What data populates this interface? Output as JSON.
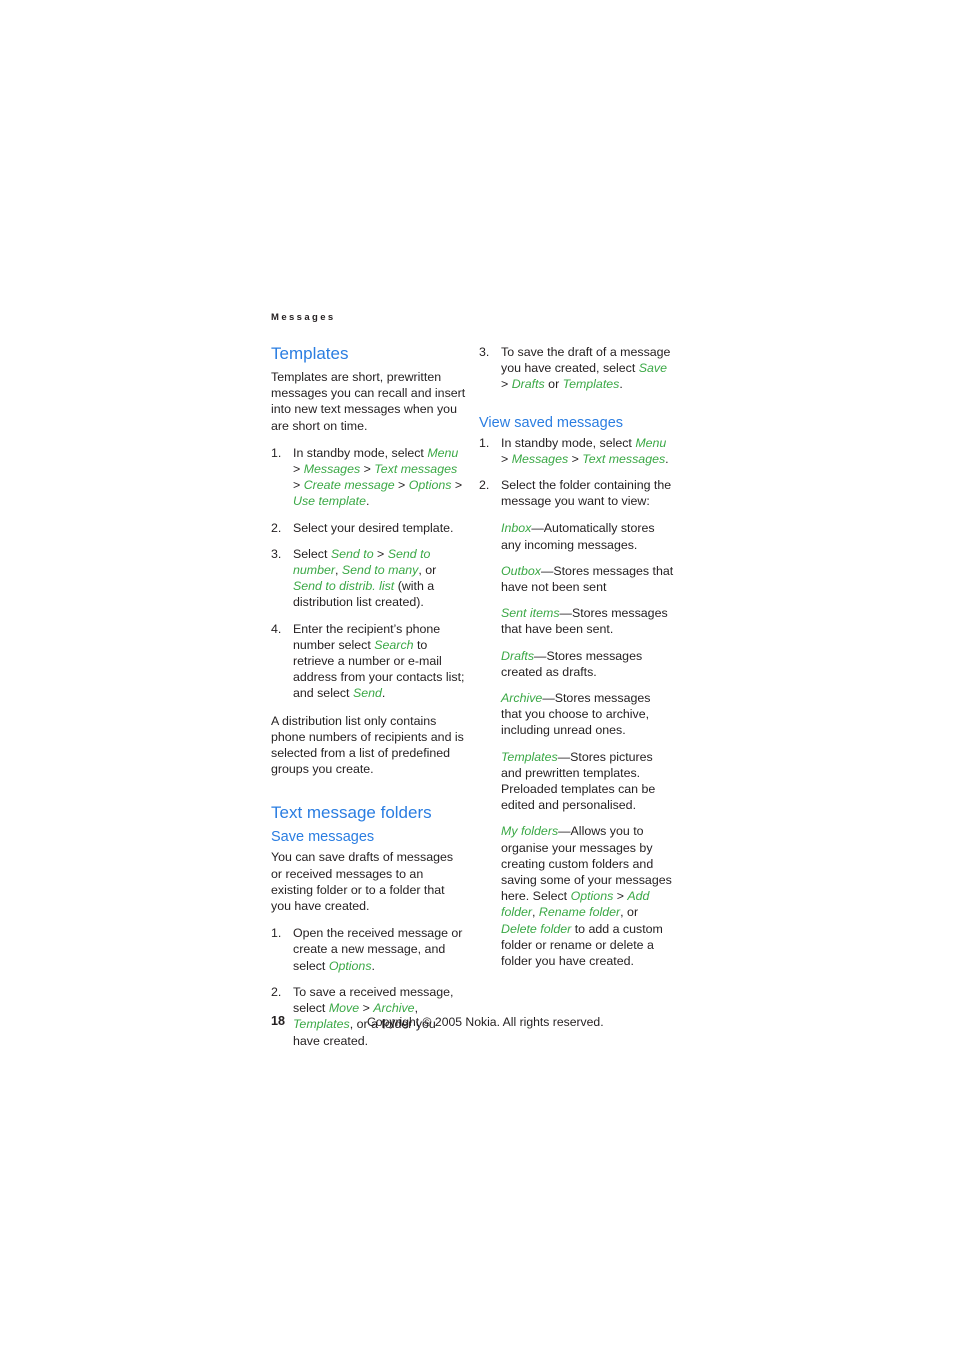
{
  "running_header": "Messages",
  "colors": {
    "heading_blue": "#2a7de1",
    "ui_green": "#3aa845",
    "body_text": "#231f20"
  },
  "left_column": {
    "heading_templates": "Templates",
    "intro": "Templates are short, prewritten messages you can recall and insert into new text messages when you are short on time.",
    "steps": [
      {
        "num": "1.",
        "parts": [
          {
            "t": "In standby mode, select ",
            "k": "plain"
          },
          {
            "t": "Menu",
            "k": "ui"
          },
          {
            "t": " > ",
            "k": "sep"
          },
          {
            "t": "Messages",
            "k": "ui"
          },
          {
            "t": " > ",
            "k": "sep"
          },
          {
            "t": "Text messages",
            "k": "ui"
          },
          {
            "t": " > ",
            "k": "sep"
          },
          {
            "t": "Create message",
            "k": "ui"
          },
          {
            "t": " > ",
            "k": "sep"
          },
          {
            "t": "Options",
            "k": "ui"
          },
          {
            "t": " > ",
            "k": "sep"
          },
          {
            "t": "Use template",
            "k": "ui"
          },
          {
            "t": ".",
            "k": "plain"
          }
        ]
      },
      {
        "num": "2.",
        "parts": [
          {
            "t": "Select your desired template.",
            "k": "plain"
          }
        ]
      },
      {
        "num": "3.",
        "parts": [
          {
            "t": "Select ",
            "k": "plain"
          },
          {
            "t": "Send to",
            "k": "ui"
          },
          {
            "t": " > ",
            "k": "sep"
          },
          {
            "t": "Send to number",
            "k": "ui"
          },
          {
            "t": ", ",
            "k": "plain"
          },
          {
            "t": "Send to many",
            "k": "ui"
          },
          {
            "t": ", or ",
            "k": "plain"
          },
          {
            "t": "Send to distrib. list",
            "k": "ui"
          },
          {
            "t": " (with a distribution list created).",
            "k": "plain"
          }
        ]
      },
      {
        "num": "4.",
        "parts": [
          {
            "t": "Enter the recipient’s phone number select ",
            "k": "plain"
          },
          {
            "t": "Search",
            "k": "ui"
          },
          {
            "t": " to retrieve a number or e-mail address from your contacts list; and select ",
            "k": "plain"
          },
          {
            "t": "Send",
            "k": "ui"
          },
          {
            "t": ".",
            "k": "plain"
          }
        ]
      }
    ],
    "distribution_note": "A distribution list only contains phone numbers of recipients and is selected from a list of predefined groups you create.",
    "heading_folders": "Text message folders",
    "subheading_save": "Save messages",
    "save_intro": "You can save drafts of messages or received messages to an existing folder or to a folder that you have created.",
    "save_steps": [
      {
        "num": "1.",
        "parts": [
          {
            "t": "Open the received message or create a new message, and select ",
            "k": "plain"
          },
          {
            "t": "Options",
            "k": "ui"
          },
          {
            "t": ".",
            "k": "plain"
          }
        ]
      },
      {
        "num": "2.",
        "parts": [
          {
            "t": "To save a received message, select ",
            "k": "plain"
          },
          {
            "t": "Move",
            "k": "ui"
          },
          {
            "t": " > ",
            "k": "sep"
          },
          {
            "t": "Archive",
            "k": "ui"
          },
          {
            "t": ", ",
            "k": "plain"
          },
          {
            "t": "Templates",
            "k": "ui"
          },
          {
            "t": ", or a folder you have created.",
            "k": "plain"
          }
        ]
      }
    ]
  },
  "right_column": {
    "step3": {
      "num": "3.",
      "parts": [
        {
          "t": "To save the draft of a message you have created, select ",
          "k": "plain"
        },
        {
          "t": "Save",
          "k": "ui"
        },
        {
          "t": " > ",
          "k": "sep"
        },
        {
          "t": "Drafts",
          "k": "ui"
        },
        {
          "t": " or ",
          "k": "plain"
        },
        {
          "t": "Templates",
          "k": "ui"
        },
        {
          "t": ".",
          "k": "plain"
        }
      ]
    },
    "subheading_view": "View saved messages",
    "view_steps": [
      {
        "num": "1.",
        "parts": [
          {
            "t": "In standby mode, select ",
            "k": "plain"
          },
          {
            "t": "Menu",
            "k": "ui"
          },
          {
            "t": " > ",
            "k": "sep"
          },
          {
            "t": "Messages",
            "k": "ui"
          },
          {
            "t": " > ",
            "k": "sep"
          },
          {
            "t": "Text messages",
            "k": "ui"
          },
          {
            "t": ".",
            "k": "plain"
          }
        ]
      },
      {
        "num": "2.",
        "parts": [
          {
            "t": "Select the folder containing the message you want to view:",
            "k": "plain"
          }
        ]
      }
    ],
    "folders": [
      {
        "parts": [
          {
            "t": "Inbox",
            "k": "ui"
          },
          {
            "t": "—Automatically stores any incoming messages.",
            "k": "plain"
          }
        ]
      },
      {
        "parts": [
          {
            "t": "Outbox",
            "k": "ui"
          },
          {
            "t": "—Stores messages that have not been sent",
            "k": "plain"
          }
        ]
      },
      {
        "parts": [
          {
            "t": "Sent items",
            "k": "ui"
          },
          {
            "t": "—Stores messages that have been sent.",
            "k": "plain"
          }
        ]
      },
      {
        "parts": [
          {
            "t": "Drafts",
            "k": "ui"
          },
          {
            "t": "—Stores messages created as drafts.",
            "k": "plain"
          }
        ]
      },
      {
        "parts": [
          {
            "t": "Archive",
            "k": "ui"
          },
          {
            "t": "—Stores messages that you choose to archive, including unread ones.",
            "k": "plain"
          }
        ]
      },
      {
        "parts": [
          {
            "t": "Templates",
            "k": "ui"
          },
          {
            "t": "—Stores pictures and prewritten templates. Preloaded templates can be edited and personalised.",
            "k": "plain"
          }
        ]
      },
      {
        "parts": [
          {
            "t": "My folders",
            "k": "ui"
          },
          {
            "t": "—Allows you to organise your messages by creating custom folders and saving some of your messages here. Select ",
            "k": "plain"
          },
          {
            "t": "Options",
            "k": "ui"
          },
          {
            "t": " > ",
            "k": "sep"
          },
          {
            "t": "Add folder",
            "k": "ui"
          },
          {
            "t": ", ",
            "k": "plain"
          },
          {
            "t": "Rename folder",
            "k": "ui"
          },
          {
            "t": ", or ",
            "k": "plain"
          },
          {
            "t": "Delete folder",
            "k": "ui"
          },
          {
            "t": " to add a custom folder or rename or delete a folder you have created.",
            "k": "plain"
          }
        ]
      }
    ]
  },
  "footer": {
    "page_number": "18",
    "copyright": "Copyright © 2005 Nokia. All rights reserved."
  }
}
